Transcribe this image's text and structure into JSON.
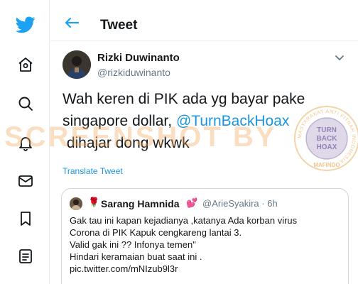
{
  "sidebar": {
    "items": [
      {
        "icon": "twitter-bird-icon"
      },
      {
        "icon": "home-icon"
      },
      {
        "icon": "search-icon"
      },
      {
        "icon": "bell-icon"
      },
      {
        "icon": "envelope-icon"
      },
      {
        "icon": "bookmark-icon"
      },
      {
        "icon": "list-icon"
      }
    ]
  },
  "header": {
    "back_icon": "arrow-left-icon",
    "title": "Tweet"
  },
  "tweet": {
    "author": {
      "name": "Rizki Duwinanto",
      "handle": "@rizkiduwinanto"
    },
    "text": {
      "line1": "Wah keren di PIK ada yg bayar pake",
      "line2": "singapore dollar,",
      "mention": "@TurnBackHoax",
      "line3": " dihajar dong wkwk"
    },
    "translate_label": "Translate Tweet",
    "quoted": {
      "emoji_before": "🌹",
      "name": "Sarang Hamnida",
      "emoji_after": "💕",
      "handle_time": "@ArieSyakira · 6h",
      "lines": [
        "Gak tau ini kapan kejadianya ,katanya Ada korban virus",
        "Corona di PIK Kapuk cengkareng lantai 3.",
        "Valid gak ini ?? Infonya temen\"",
        "Hindari keramaian buat saat ini .",
        "pic.twitter.com/mNIzub9l3r"
      ]
    }
  },
  "watermark": {
    "text": "SCREENSHOT BY",
    "seal_top": "TURN BACK HOAX",
    "seal_ring": "MASYARAKAT ANTI FITNAH INDONESIA",
    "seal_bottom": "MAFINDO"
  },
  "colors": {
    "accent": "#1da1f2",
    "link": "#1b95e0",
    "watermark": "#f2a95f",
    "seal": "#6a4c9c"
  }
}
